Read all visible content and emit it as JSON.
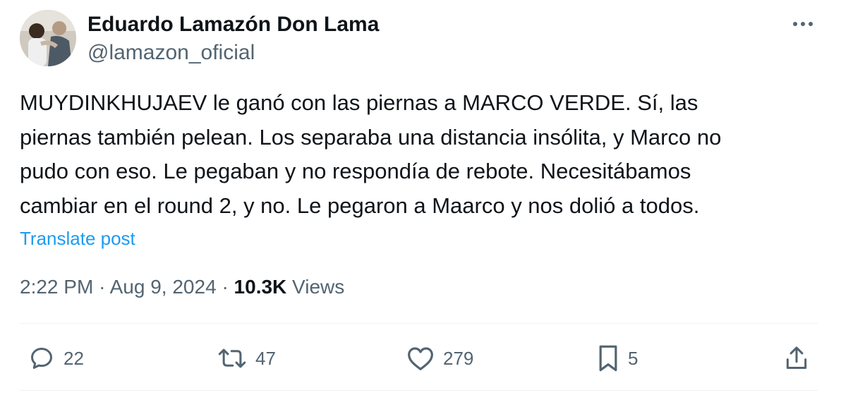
{
  "author": {
    "name": "Eduardo Lamazón Don Lama",
    "handle": "@lamazon_oficial"
  },
  "tweet": {
    "text_lines": [
      "MUYDINKHUJAEV le ganó con las piernas a MARCO VERDE. Sí, las",
      "piernas también pelean. Los separaba una distancia insólita, y Marco no",
      "pudo con eso. Le pegaban y no respondía de rebote. Necesitábamos",
      "cambiar en el round 2, y no. Le pegaron a Maarco y nos dolió a todos."
    ],
    "translate_label": "Translate post"
  },
  "meta": {
    "time": "2:22 PM",
    "separator": "·",
    "date": "Aug 9, 2024",
    "views_count": "10.3K",
    "views_label": "Views"
  },
  "actions": {
    "replies": "22",
    "reposts": "47",
    "likes": "279",
    "bookmarks": "5"
  },
  "icons": {
    "more": "more-horizontal-icon",
    "reply": "reply-icon",
    "repost": "repost-icon",
    "like": "heart-icon",
    "bookmark": "bookmark-icon",
    "share": "share-icon"
  },
  "colors": {
    "text_primary": "#0f1419",
    "text_secondary": "#536471",
    "link": "#1d9bf0",
    "divider": "#eff3f4"
  }
}
